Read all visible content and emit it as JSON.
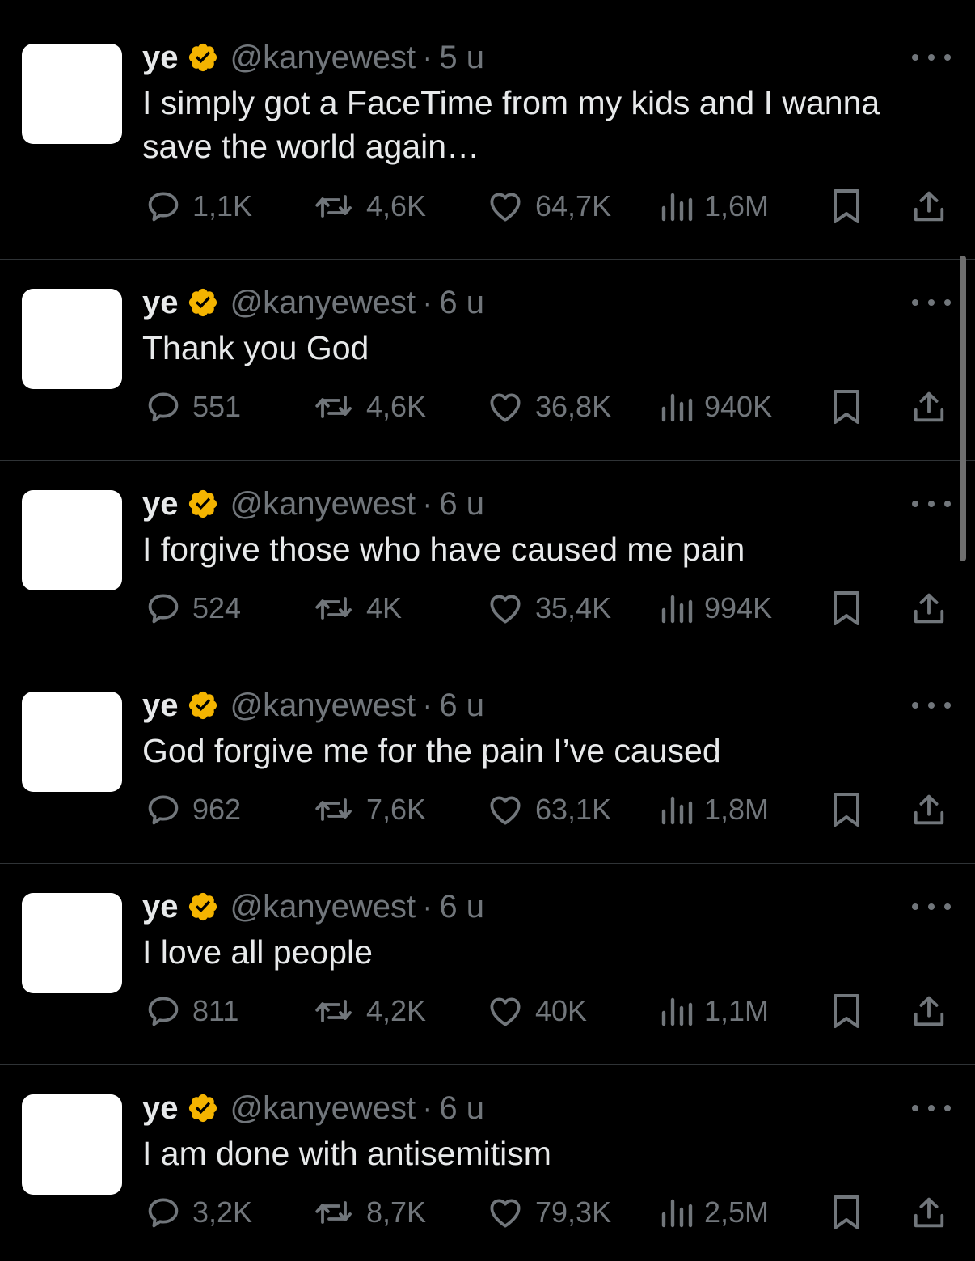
{
  "tweets": [
    {
      "name": "ye",
      "handle": "@kanyewest",
      "time": "5 u",
      "text": "I simply got a FaceTime from my kids and I wanna save the world again…",
      "replies": "1,1K",
      "reposts": "4,6K",
      "likes": "64,7K",
      "views": "1,6M"
    },
    {
      "name": "ye",
      "handle": "@kanyewest",
      "time": "6 u",
      "text": "Thank you God",
      "replies": "551",
      "reposts": "4,6K",
      "likes": "36,8K",
      "views": "940K"
    },
    {
      "name": "ye",
      "handle": "@kanyewest",
      "time": "6 u",
      "text": "I forgive those who have caused me pain",
      "replies": "524",
      "reposts": "4K",
      "likes": "35,4K",
      "views": "994K"
    },
    {
      "name": "ye",
      "handle": "@kanyewest",
      "time": "6 u",
      "text": "God forgive me for the pain I’ve caused",
      "replies": "962",
      "reposts": "7,6K",
      "likes": "63,1K",
      "views": "1,8M"
    },
    {
      "name": "ye",
      "handle": "@kanyewest",
      "time": "6 u",
      "text": "I love all people",
      "replies": "811",
      "reposts": "4,2K",
      "likes": "40K",
      "views": "1,1M"
    },
    {
      "name": "ye",
      "handle": "@kanyewest",
      "time": "6 u",
      "text": "I am done with antisemitism",
      "replies": "3,2K",
      "reposts": "8,7K",
      "likes": "79,3K",
      "views": "2,5M"
    }
  ],
  "separator": "·",
  "icons": {
    "verified": "verified-badge-icon",
    "reply": "reply-icon",
    "repost": "repost-icon",
    "like": "heart-icon",
    "views": "views-icon",
    "bookmark": "bookmark-icon",
    "share": "share-icon",
    "more": "more-icon"
  },
  "colors": {
    "background": "#000000",
    "text": "#e7e9ea",
    "muted": "#71767b",
    "verified": "#f4b400",
    "divider": "#2f3336"
  }
}
